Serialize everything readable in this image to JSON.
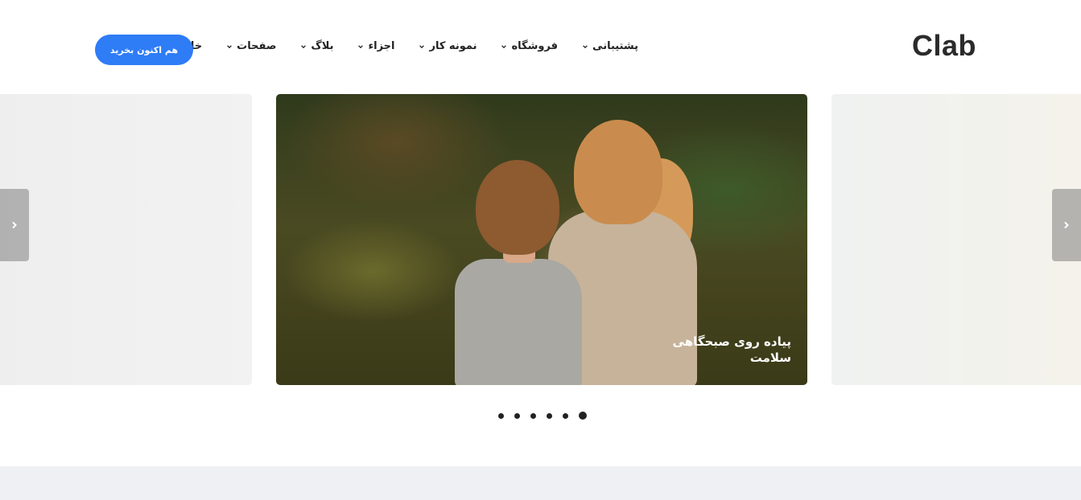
{
  "brand": {
    "logo_text": "Clab"
  },
  "nav": {
    "items": [
      {
        "label": "خانه",
        "icon": "chevron-down-icon"
      },
      {
        "label": "صفحات",
        "icon": "chevron-down-icon"
      },
      {
        "label": "بلاگ",
        "icon": "chevron-down-icon"
      },
      {
        "label": "اجزاء",
        "icon": "chevron-down-icon"
      },
      {
        "label": "نمونه کار",
        "icon": "chevron-down-icon"
      },
      {
        "label": "فروشگاه",
        "icon": "chevron-down-icon"
      },
      {
        "label": "پشتیبانی",
        "icon": "chevron-down-icon"
      }
    ],
    "cta_label": "هم اکنون بخرید"
  },
  "slider": {
    "active_caption": "پیاده روی صبحگاهی سلامت",
    "prev_icon": "chevron-left-icon",
    "next_icon": "chevron-right-icon",
    "dot_count": 6,
    "active_dot": 6
  },
  "colors": {
    "accent": "#2e7cf6",
    "text": "#222222",
    "footer_band": "#eff0f3"
  }
}
